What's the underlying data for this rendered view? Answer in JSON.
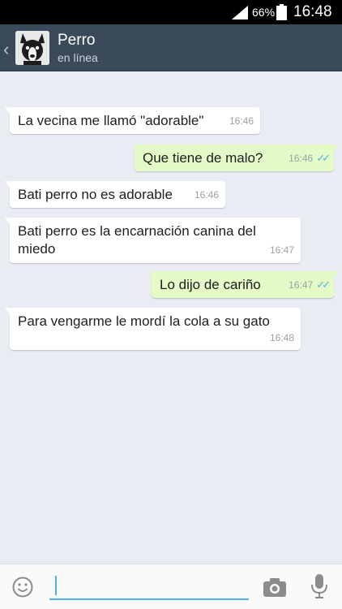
{
  "status_bar": {
    "battery_percent": "66%",
    "time": "16:48"
  },
  "header": {
    "contact_name": "Perro",
    "contact_status": "en línea",
    "back_icon": "chevron-left-icon"
  },
  "messages": [
    {
      "direction": "in",
      "text": "La vecina me llamó \"adorable\"",
      "time": "16:46"
    },
    {
      "direction": "out",
      "text": "Que tiene de malo?",
      "time": "16:46",
      "status": "read"
    },
    {
      "direction": "in",
      "text": "Bati perro no es adorable",
      "time": "16:46"
    },
    {
      "direction": "in",
      "text": "Bati perro es la encarnación canina del miedo",
      "time": "16:47"
    },
    {
      "direction": "out",
      "text": "Lo dijo de cariño",
      "time": "16:47",
      "status": "read"
    },
    {
      "direction": "in",
      "text": "Para vengarme le mordí la cola a su gato",
      "time": "16:48"
    }
  ],
  "input_bar": {
    "text_value": "",
    "icons": [
      "emoji-icon",
      "camera-icon",
      "microphone-icon"
    ]
  },
  "colors": {
    "header_bg": "#3b4a5a",
    "chat_bg": "#e9ecf2",
    "incoming_bubble": "#ffffff",
    "outgoing_bubble": "#e4fbc8",
    "read_ticks": "#4fb3e8"
  }
}
